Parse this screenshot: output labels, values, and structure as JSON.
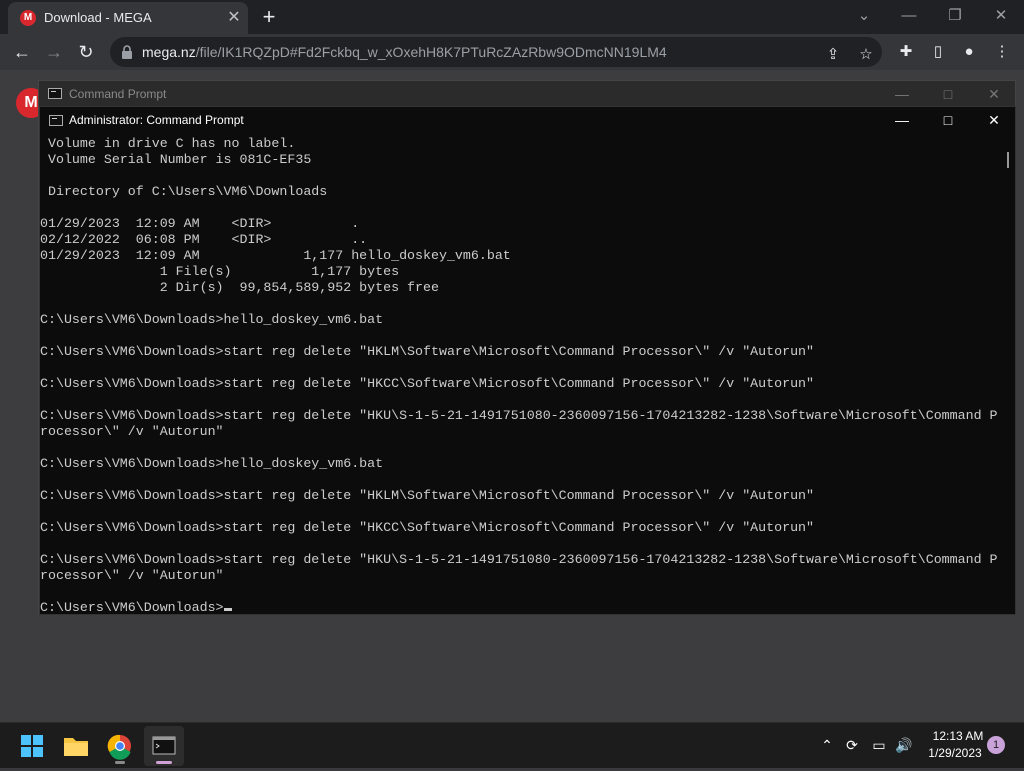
{
  "browser": {
    "tab_title": "Download - MEGA",
    "tab_favicon": "M",
    "new_tab_symbol": "+",
    "url_host": "mega.nz",
    "url_path": "/file/IK1RQZpD#Fd2Fckbq_w_xOxehH8K7PTuRcZAzRbw9ODmcNN19LM4",
    "accent": "#d9272e"
  },
  "page": {
    "logo_letter": "M"
  },
  "cmd_back": {
    "title": "Command Prompt"
  },
  "cmd": {
    "title": "Administrator: Command Prompt",
    "lines": [
      " Volume in drive C has no label.",
      " Volume Serial Number is 081C-EF35",
      "",
      " Directory of C:\\Users\\VM6\\Downloads",
      "",
      "01/29/2023  12:09 AM    <DIR>          .",
      "02/12/2022  06:08 PM    <DIR>          ..",
      "01/29/2023  12:09 AM             1,177 hello_doskey_vm6.bat",
      "               1 File(s)          1,177 bytes",
      "               2 Dir(s)  99,854,589,952 bytes free",
      "",
      "C:\\Users\\VM6\\Downloads>hello_doskey_vm6.bat",
      "",
      "C:\\Users\\VM6\\Downloads>start reg delete \"HKLM\\Software\\Microsoft\\Command Processor\\\" /v \"Autorun\"",
      "",
      "C:\\Users\\VM6\\Downloads>start reg delete \"HKCC\\Software\\Microsoft\\Command Processor\\\" /v \"Autorun\"",
      "",
      "C:\\Users\\VM6\\Downloads>start reg delete \"HKU\\S-1-5-21-1491751080-2360097156-1704213282-1238\\Software\\Microsoft\\Command P",
      "rocessor\\\" /v \"Autorun\"",
      "",
      "C:\\Users\\VM6\\Downloads>hello_doskey_vm6.bat",
      "",
      "C:\\Users\\VM6\\Downloads>start reg delete \"HKLM\\Software\\Microsoft\\Command Processor\\\" /v \"Autorun\"",
      "",
      "C:\\Users\\VM6\\Downloads>start reg delete \"HKCC\\Software\\Microsoft\\Command Processor\\\" /v \"Autorun\"",
      "",
      "C:\\Users\\VM6\\Downloads>start reg delete \"HKU\\S-1-5-21-1491751080-2360097156-1704213282-1238\\Software\\Microsoft\\Command P",
      "rocessor\\\" /v \"Autorun\"",
      ""
    ],
    "prompt": "C:\\Users\\VM6\\Downloads>"
  },
  "taskbar": {
    "time": "12:13 AM",
    "date": "1/29/2023",
    "notification_count": "1",
    "apps": [
      "windows-start-icon",
      "file-explorer-icon",
      "chrome-icon",
      "terminal-icon"
    ]
  }
}
